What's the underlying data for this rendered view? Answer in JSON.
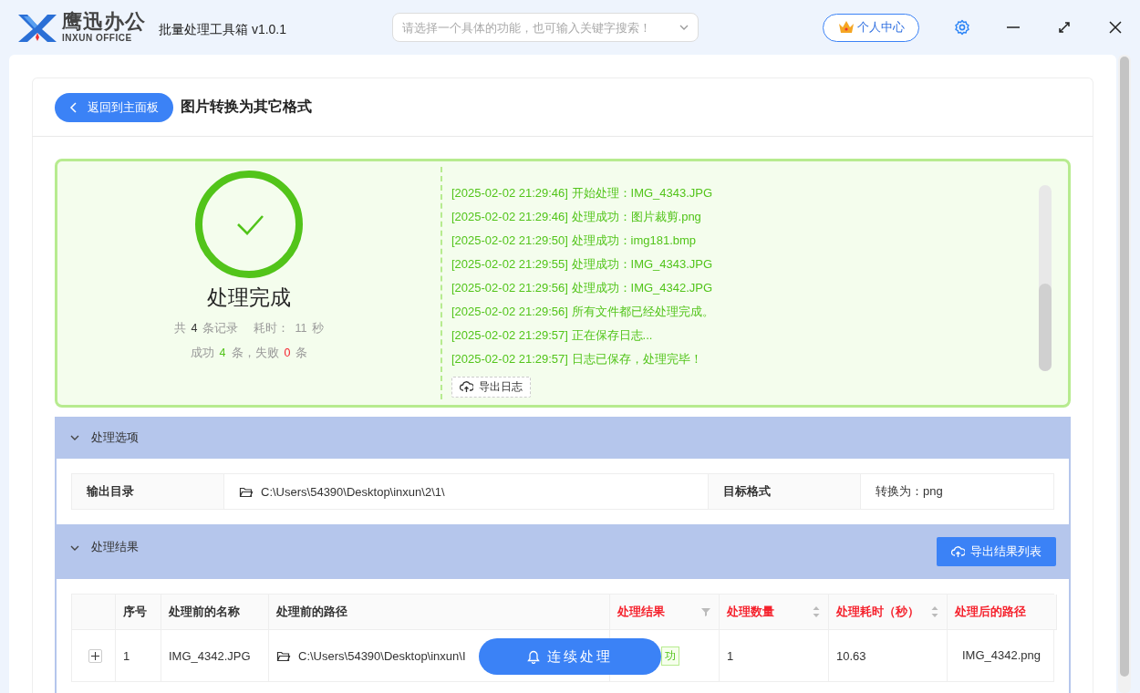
{
  "app": {
    "logo_cn": "鹰迅办公",
    "logo_en": "INXUN OFFICE",
    "title": "批量处理工具箱 v1.0.1"
  },
  "search": {
    "placeholder": "请选择一个具体的功能，也可输入关键字搜索！"
  },
  "user_button": "个人中心",
  "page": {
    "back_button": "返回到主面板",
    "title": "图片转换为其它格式"
  },
  "result": {
    "status": "处理完成",
    "stats": [
      [
        {
          "kind": "plain",
          "text": "共"
        },
        {
          "kind": "dark",
          "text": "4"
        },
        {
          "kind": "plain",
          "text": "条记录"
        },
        {
          "kind": "gap",
          "text": "耗时："
        },
        {
          "kind": "plain",
          "text": "11"
        },
        {
          "kind": "plain",
          "text": "秒"
        }
      ],
      [
        {
          "kind": "plain",
          "text": "成功"
        },
        {
          "kind": "green",
          "text": "4"
        },
        {
          "kind": "plain",
          "text": "条，失败"
        },
        {
          "kind": "red",
          "text": "0"
        },
        {
          "kind": "plain",
          "text": "条"
        }
      ]
    ],
    "log": [
      "[2025-02-02 21:29:46] 开始处理：IMG_4343.JPG",
      "[2025-02-02 21:29:46] 处理成功：图片裁剪.png",
      "[2025-02-02 21:29:50] 处理成功：img181.bmp",
      "[2025-02-02 21:29:55] 处理成功：IMG_4343.JPG",
      "[2025-02-02 21:29:56] 处理成功：IMG_4342.JPG",
      "[2025-02-02 21:29:56] 所有文件都已经处理完成。",
      "[2025-02-02 21:29:57] 正在保存日志...",
      "[2025-02-02 21:29:57] 日志已保存，处理完毕！"
    ],
    "export_log_button": "导出日志"
  },
  "options": {
    "title": "处理选项",
    "expanded": true,
    "fields": [
      {
        "label": "输出目录",
        "value": "C:\\Users\\54390\\Desktop\\inxun\\2\\1\\",
        "kind": "folder"
      },
      {
        "label": "目标格式",
        "value": "转换为：png",
        "kind": "text"
      }
    ]
  },
  "results": {
    "title": "处理结果",
    "expanded": true,
    "export_button": "导出结果列表",
    "columns": [
      {
        "label": "序号",
        "highlighted": false,
        "kind": "plain"
      },
      {
        "label": "处理前的名称",
        "highlighted": false,
        "kind": "plain"
      },
      {
        "label": "处理前的路径",
        "highlighted": false,
        "kind": "plain"
      },
      {
        "label": "处理结果",
        "highlighted": true,
        "kind": "filter"
      },
      {
        "label": "处理数量",
        "highlighted": true,
        "kind": "sort"
      },
      {
        "label": "处理耗时（秒）",
        "highlighted": true,
        "kind": "sort"
      },
      {
        "label": "处理后的路径",
        "highlighted": true,
        "kind": "plain"
      }
    ],
    "rows": [
      {
        "expanded": false,
        "cells": [
          "1",
          "IMG_4342.JPG",
          "C:\\Users\\54390\\Desktop\\inxun\\I",
          "功",
          "1",
          "10.63",
          "IMG_4342.png"
        ]
      }
    ]
  },
  "continue_button": "连续处理"
}
